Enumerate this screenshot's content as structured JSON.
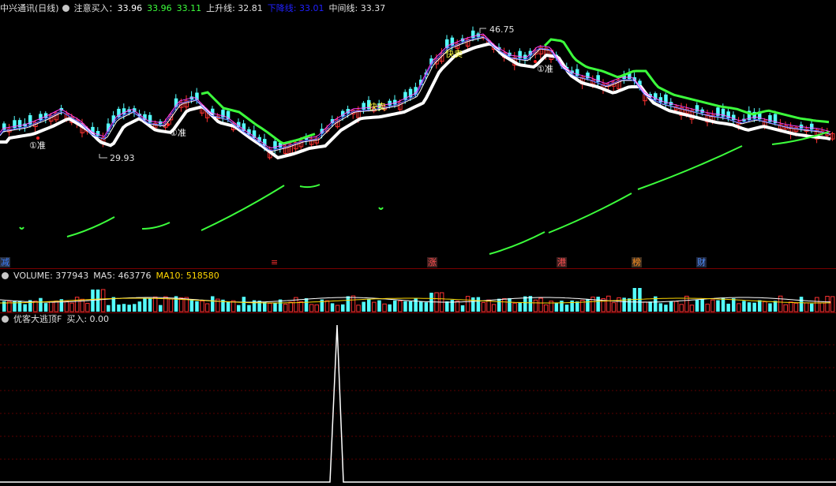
{
  "main_header": {
    "title": "中兴通讯(日线)",
    "buy_label": "注意买入：",
    "buy_value": "33.96",
    "val2": "33.96",
    "val3": "33.11",
    "up_label": "上升线: 32.81",
    "down_label": "下降线: 33.01",
    "mid_label": "中间线: 33.37"
  },
  "annotations": {
    "high": "46.75",
    "low": "29.93",
    "zhun1": "①准",
    "zhun2": "①准",
    "zhun3": "①准",
    "kuaimai1": "快卖",
    "kuaimai2": "快卖"
  },
  "event_tags": [
    {
      "text": "减",
      "color": "#3a80ff",
      "bg": "#2a3040"
    },
    {
      "text": "≡",
      "color": "#ff3030",
      "bg": "#000000"
    },
    {
      "text": "涨",
      "color": "#ff5050",
      "bg": "#402020"
    },
    {
      "text": "港",
      "color": "#ff5050",
      "bg": "#402020"
    },
    {
      "text": "榜",
      "color": "#ff9020",
      "bg": "#403020"
    },
    {
      "text": "财",
      "color": "#5090ff",
      "bg": "#202840"
    }
  ],
  "volume_header": {
    "label": "VOLUME: 377943",
    "ma5": "MA5: 463776",
    "ma10": "MA10: 518580"
  },
  "indicator_header": {
    "label": "优客大逃顶F",
    "buy": "买入: 0.00"
  },
  "colors": {
    "up": "#ff3232",
    "down": "#54ffff",
    "green_line": "#3cff3c",
    "white_line": "#ffffff"
  }
}
